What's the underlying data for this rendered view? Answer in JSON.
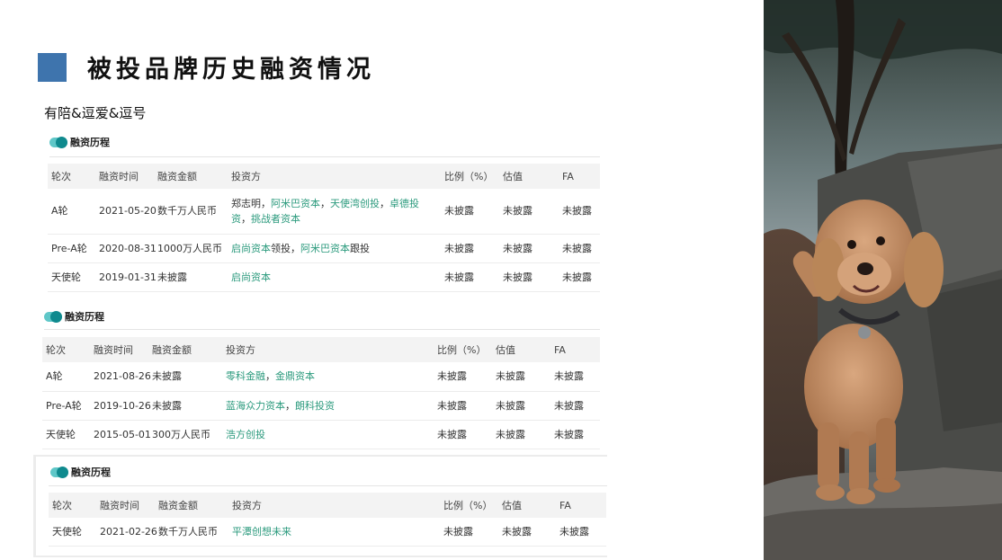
{
  "page": {
    "title": "被投品牌历史融资情况",
    "subtitle": "有陪&逗爱&逗号",
    "accent_color": "#3e74ad",
    "link_color": "#2b9a7d"
  },
  "panels": [
    {
      "title": "融资历程",
      "headers": [
        "轮次",
        "融资时间",
        "融资金额",
        "投资方",
        "比例（%）",
        "估值",
        "FA"
      ],
      "rows": [
        {
          "round": "A轮",
          "date": "2021-05-20",
          "amount": "数千万人民币",
          "investors": [
            {
              "text": "郑志明",
              "link": false
            },
            {
              "text": "，",
              "link": false
            },
            {
              "text": "阿米巴资本",
              "link": true
            },
            {
              "text": "，",
              "link": false
            },
            {
              "text": "天使湾创投",
              "link": true
            },
            {
              "text": "，",
              "link": false
            },
            {
              "text": "卓德投资",
              "link": true
            },
            {
              "text": "，",
              "link": false
            },
            {
              "text": "挑战者资本",
              "link": true
            }
          ],
          "ratio": "未披露",
          "valuation": "未披露",
          "fa": "未披露"
        },
        {
          "round": "Pre-A轮",
          "date": "2020-08-31",
          "amount": "1000万人民币",
          "investors": [
            {
              "text": "启尚资本",
              "link": true
            },
            {
              "text": "领投，",
              "link": false
            },
            {
              "text": "阿米巴资本",
              "link": true
            },
            {
              "text": "跟投",
              "link": false
            }
          ],
          "ratio": "未披露",
          "valuation": "未披露",
          "fa": "未披露"
        },
        {
          "round": "天使轮",
          "date": "2019-01-31",
          "amount": "未披露",
          "investors": [
            {
              "text": "启尚资本",
              "link": true
            }
          ],
          "ratio": "未披露",
          "valuation": "未披露",
          "fa": "未披露"
        }
      ]
    },
    {
      "title": "融资历程",
      "headers": [
        "轮次",
        "融资时间",
        "融资金额",
        "投资方",
        "比例（%）",
        "估值",
        "FA"
      ],
      "rows": [
        {
          "round": "A轮",
          "date": "2021-08-26",
          "amount": "未披露",
          "investors": [
            {
              "text": "零科金融",
              "link": true
            },
            {
              "text": "，",
              "link": false
            },
            {
              "text": "金鼎资本",
              "link": true
            }
          ],
          "ratio": "未披露",
          "valuation": "未披露",
          "fa": "未披露"
        },
        {
          "round": "Pre-A轮",
          "date": "2019-10-26",
          "amount": "未披露",
          "investors": [
            {
              "text": "蓝海众力资本",
              "link": true
            },
            {
              "text": "，",
              "link": false
            },
            {
              "text": "朗科投资",
              "link": true
            }
          ],
          "ratio": "未披露",
          "valuation": "未披露",
          "fa": "未披露"
        },
        {
          "round": "天使轮",
          "date": "2015-05-01",
          "amount": "300万人民币",
          "investors": [
            {
              "text": "浩方创投",
              "link": true
            }
          ],
          "ratio": "未披露",
          "valuation": "未披露",
          "fa": "未披露"
        }
      ]
    },
    {
      "title": "融资历程",
      "headers": [
        "轮次",
        "融资时间",
        "融资金额",
        "投资方",
        "比例（%）",
        "估值",
        "FA"
      ],
      "rows": [
        {
          "round": "天使轮",
          "date": "2021-02-26",
          "amount": "数千万人民币",
          "investors": [
            {
              "text": "平潭创想未来",
              "link": true
            }
          ],
          "ratio": "未披露",
          "valuation": "未披露",
          "fa": "未披露"
        }
      ]
    }
  ]
}
